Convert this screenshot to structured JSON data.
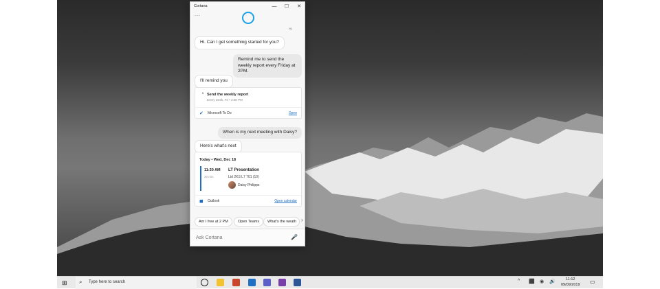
{
  "window": {
    "title": "Cortana",
    "more_label": "...",
    "hi_tag": "Hi",
    "controls": {
      "minimize": "—",
      "maximize": "☐",
      "close": "✕"
    }
  },
  "conversation": {
    "greeting": "Hi. Can I get something started for you?",
    "user_request_1": "Remind me to send the weekly report every Friday at 2PM.",
    "reply_1": "I'll remind you",
    "reminder_card": {
      "title": "Send the weekly report",
      "detail": "Every week, Fri • 2:00 PM",
      "source": "Microsoft To Do",
      "action": "Open"
    },
    "user_request_2": "When is my next meeting with Daisy?",
    "reply_2": "Here's what's next",
    "meeting_card": {
      "date": "Today • Wed, Dec 18",
      "time": "11:30 AM",
      "duration": "30 min",
      "title": "LT Presentation",
      "location": "Ltd 2KS L7 701 (10)",
      "attendee": "Daisy Philipps",
      "source": "Outlook",
      "action": "Open calendar"
    }
  },
  "suggestions": [
    "Am I free at 2 PM",
    "Open Teams",
    "What's the weath"
  ],
  "suggestions_chevron": "›",
  "ask": {
    "placeholder": "Ask Cortana"
  },
  "taskbar": {
    "search_text": "Type here to search",
    "apps": [
      {
        "name": "file-explorer",
        "color": "#f2c230"
      },
      {
        "name": "powerpoint",
        "color": "#c9452b"
      },
      {
        "name": "outlook",
        "color": "#1f6fc2"
      },
      {
        "name": "teams",
        "color": "#5b5fc7"
      },
      {
        "name": "onenote",
        "color": "#7a3ea8"
      },
      {
        "name": "word",
        "color": "#2b5797"
      }
    ],
    "tray_icons": [
      "^",
      "⬛",
      "◉",
      "🔊",
      "▭"
    ],
    "time": "11:12",
    "date": "09/09/2019"
  }
}
